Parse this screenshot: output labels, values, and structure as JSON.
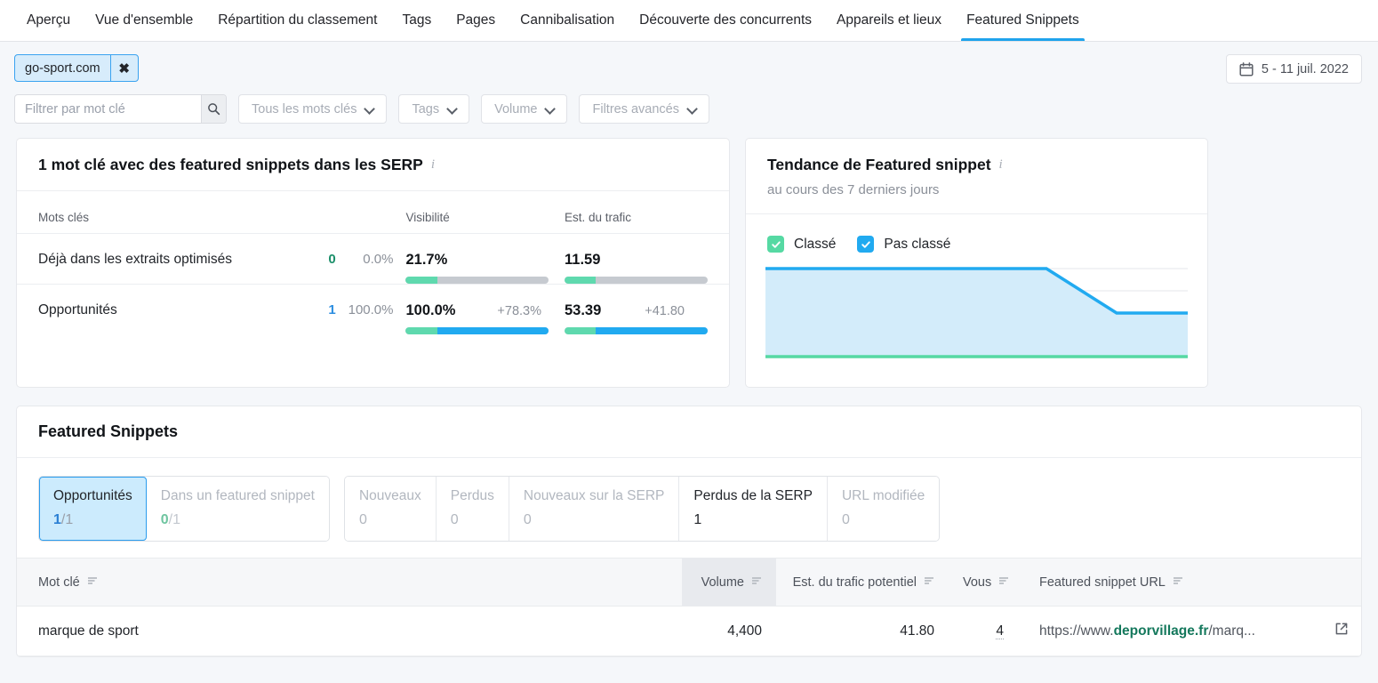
{
  "nav": {
    "items": [
      {
        "label": "Aperçu",
        "active": false
      },
      {
        "label": "Vue d'ensemble",
        "active": false
      },
      {
        "label": "Répartition du classement",
        "active": false
      },
      {
        "label": "Tags",
        "active": false
      },
      {
        "label": "Pages",
        "active": false
      },
      {
        "label": "Cannibalisation",
        "active": false
      },
      {
        "label": "Découverte des concurrents",
        "active": false
      },
      {
        "label": "Appareils et lieux",
        "active": false
      },
      {
        "label": "Featured Snippets",
        "active": true
      }
    ]
  },
  "filters": {
    "domain_chip": "go-sport.com",
    "search_placeholder": "Filtrer par mot clé",
    "dropdowns": [
      "Tous les mots clés",
      "Tags",
      "Volume",
      "Filtres avancés"
    ],
    "date_range": "5 - 11 juil. 2022"
  },
  "keyword_card": {
    "title": "1 mot clé avec des featured snippets dans les SERP",
    "columns": {
      "name": "Mots clés",
      "visibility": "Visibilité",
      "traffic": "Est. du trafic"
    },
    "rows": [
      {
        "name": "Déjà dans les extraits optimisés",
        "count": "0",
        "count_pct": "0.0%",
        "visibility": "21.7%",
        "visibility_delta": "",
        "visibility_green_pct": 22,
        "visibility_blue_pct": 0,
        "traffic": "11.59",
        "traffic_delta": "",
        "traffic_green_pct": 22,
        "traffic_blue_pct": 0
      },
      {
        "name": "Opportunités",
        "count": "1",
        "count_pct": "100.0%",
        "visibility": "100.0%",
        "visibility_delta": "+78.3%",
        "visibility_green_pct": 22,
        "visibility_blue_pct": 78,
        "traffic": "53.39",
        "traffic_delta": "+41.80",
        "traffic_green_pct": 22,
        "traffic_blue_pct": 78
      }
    ]
  },
  "trend_card": {
    "title": "Tendance de Featured snippet",
    "subtitle": "au cours des 7 derniers jours",
    "legend": [
      {
        "label": "Classé",
        "color": "#56d9a3",
        "checked": true
      },
      {
        "label": "Pas classé",
        "color": "#21aaf0",
        "checked": true
      }
    ]
  },
  "chart_data": {
    "type": "area",
    "title": "Tendance de Featured snippet",
    "subtitle": "au cours des 7 derniers jours",
    "x": [
      1,
      2,
      3,
      4,
      5,
      6,
      7
    ],
    "xlabel": "",
    "ylabel": "",
    "ylim": [
      0,
      100
    ],
    "grid": true,
    "legend_position": "top-left",
    "series": [
      {
        "name": "Pas classé",
        "color": "#21aaf0",
        "values": [
          100,
          100,
          100,
          100,
          100,
          50,
          50
        ]
      },
      {
        "name": "Classé",
        "color": "#56d9a3",
        "values": [
          0,
          0,
          0,
          0,
          0,
          0,
          0
        ]
      }
    ]
  },
  "panel": {
    "title": "Featured Snippets",
    "tab_group_1": [
      {
        "label": "Opportunités",
        "num": "1",
        "den": "/1",
        "selected": true,
        "enabled": true
      },
      {
        "label": "Dans un featured snippet",
        "num": "0",
        "den": "/1",
        "selected": false,
        "enabled": false
      }
    ],
    "tab_group_2": [
      {
        "label": "Nouveaux",
        "num": "0",
        "den": "",
        "selected": false,
        "enabled": false
      },
      {
        "label": "Perdus",
        "num": "0",
        "den": "",
        "selected": false,
        "enabled": false
      },
      {
        "label": "Nouveaux sur la SERP",
        "num": "0",
        "den": "",
        "selected": false,
        "enabled": false
      },
      {
        "label": "Perdus de la SERP",
        "num": "1",
        "den": "",
        "selected": false,
        "enabled": true
      },
      {
        "label": "URL modifiée",
        "num": "0",
        "den": "",
        "selected": false,
        "enabled": false
      }
    ],
    "table": {
      "headers": {
        "keyword": "Mot clé",
        "volume": "Volume",
        "potential_traffic": "Est. du trafic potentiel",
        "you": "Vous",
        "snippet_url": "Featured snippet URL"
      },
      "rows": [
        {
          "keyword": "marque de sport",
          "volume": "4,400",
          "potential_traffic": "41.80",
          "you": "4",
          "url_prefix": "https://www.",
          "url_domain": "deporvillage.fr",
          "url_suffix": "/marq..."
        }
      ]
    }
  }
}
